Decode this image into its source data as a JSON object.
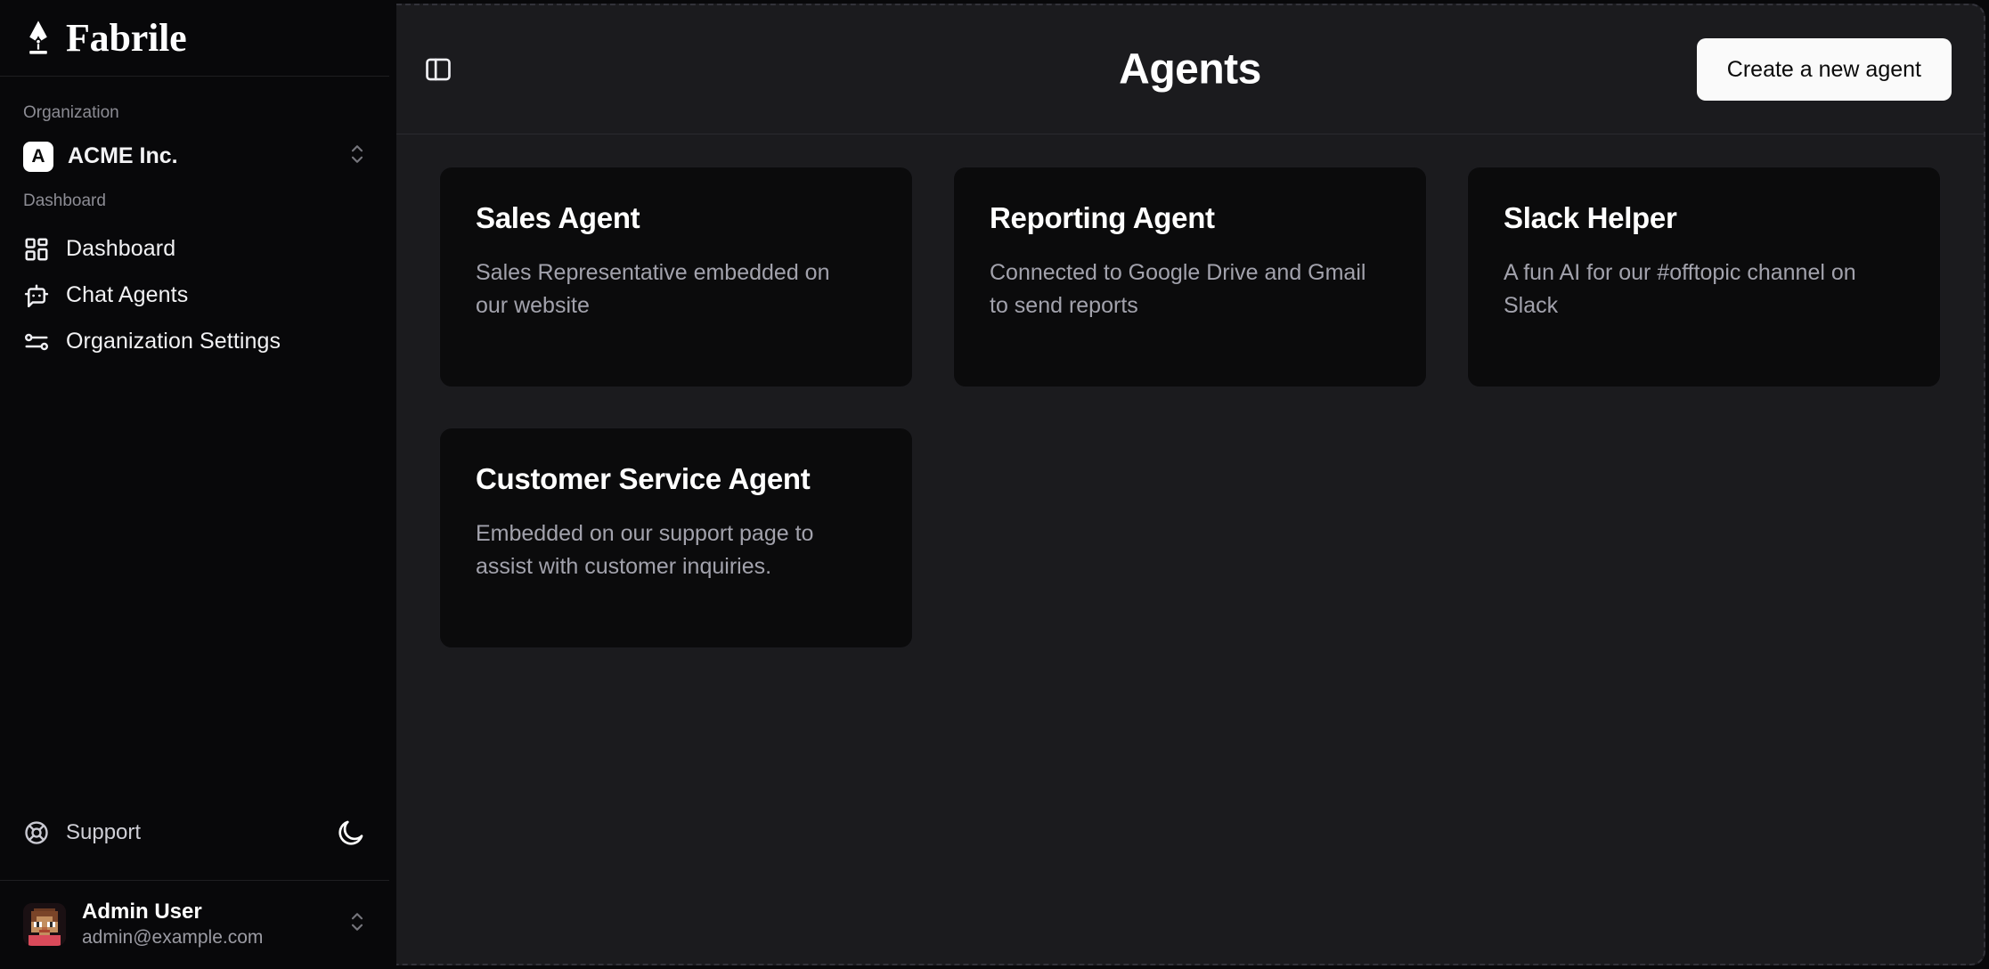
{
  "brand": {
    "name": "Fabrile",
    "icon": "pen-nib-icon"
  },
  "sidebar": {
    "organization_section_label": "Organization",
    "organization": {
      "initial": "A",
      "name": "ACME Inc.",
      "selector_icon": "chevrons-up-down-icon"
    },
    "dashboard_section_label": "Dashboard",
    "nav_items": [
      {
        "label": "Dashboard",
        "icon": "layout-dashboard-icon"
      },
      {
        "label": "Chat Agents",
        "icon": "bot-message-square-icon"
      },
      {
        "label": "Organization Settings",
        "icon": "settings-sliders-icon"
      }
    ],
    "support": {
      "label": "Support",
      "icon": "lifebuoy-icon"
    },
    "theme_toggle": {
      "icon": "moon-icon",
      "mode": "dark"
    },
    "user": {
      "name": "Admin User",
      "email": "admin@example.com",
      "avatar": "pixel-avatar",
      "selector_icon": "chevrons-up-down-icon"
    }
  },
  "topbar": {
    "sidebar_toggle_icon": "panel-left-icon",
    "title": "Agents",
    "create_button_label": "Create a new agent"
  },
  "agents": [
    {
      "title": "Sales Agent",
      "description": "Sales Representative embedded on our website"
    },
    {
      "title": "Reporting Agent",
      "description": "Connected to Google Drive and Gmail to send reports"
    },
    {
      "title": "Slack Helper",
      "description": "A fun AI for our #offtopic channel on Slack"
    },
    {
      "title": "Customer Service Agent",
      "description": "Embedded on our support page to assist with customer inquiries."
    }
  ],
  "colors": {
    "page_background": "#08080a",
    "main_background": "#1b1b1e",
    "card_background": "#0b0b0c",
    "accent_button": "#fafafa",
    "text_primary": "#ffffff",
    "text_muted": "#a2a2ac"
  }
}
